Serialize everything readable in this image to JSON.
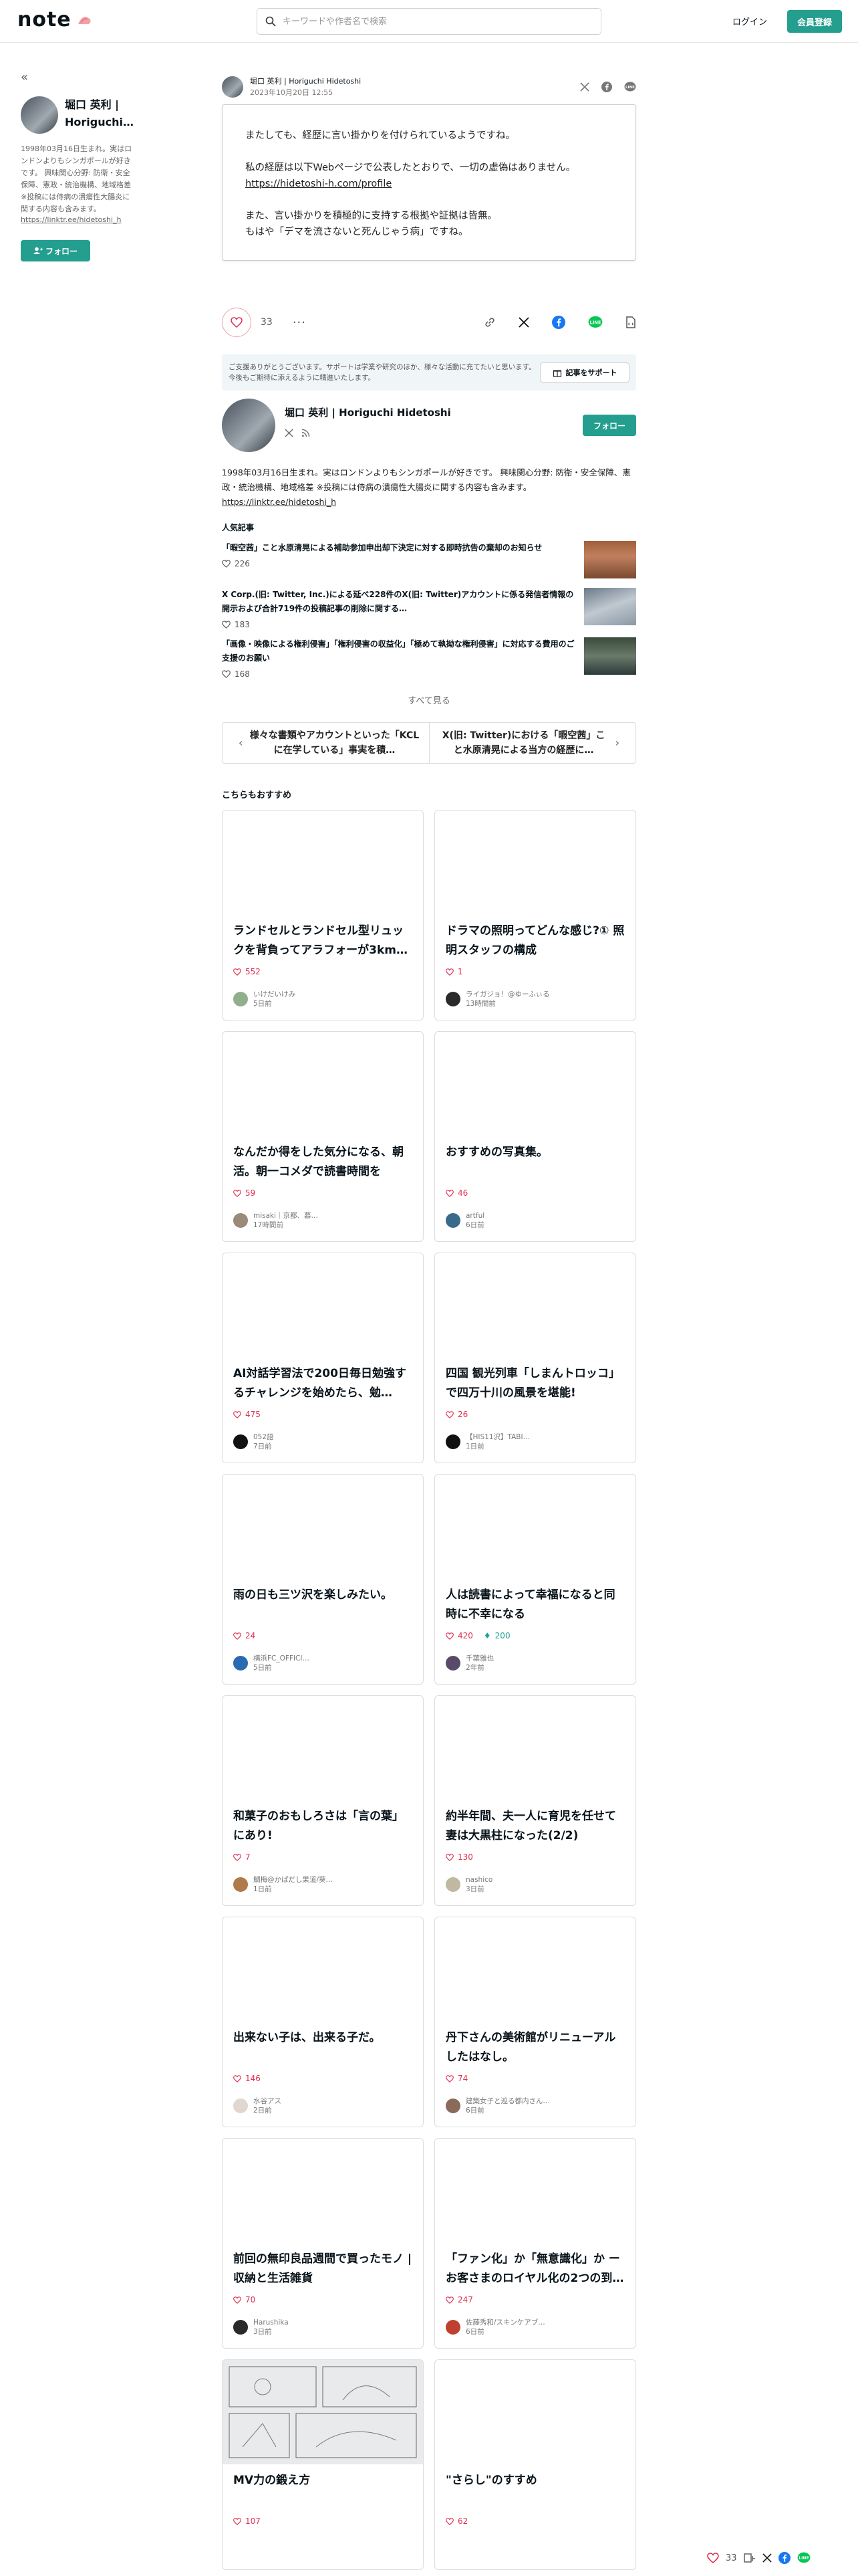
{
  "header": {
    "logo": "note",
    "search_placeholder": "キーワードや作者名で検索",
    "login": "ログイン",
    "signup": "会員登録"
  },
  "sidebar": {
    "name": "堀口 英利 | Horiguchi…",
    "bio": "1998年03月16日生まれ。実はロンドンよりもシンガポールが好きです。 興味関心分野: 防衛・安全保障、憲政・統治機構、地域格差 ※投稿には侍病の潰瘍性大腸炎に関する内容も含みます。",
    "link": "https://linktr.ee/hidetoshi_h",
    "follow": "フォロー"
  },
  "tweet": {
    "author": "堀口 英利 | Horiguchi Hidetoshi",
    "date": "2023年10月20日 12:55",
    "line1": "またしても、経歴に言い掛かりを付けられているようですね。",
    "line2": "私の経歴は以下Webページで公表したとおりで、一切の虚偽はありません。",
    "link": "https://hidetoshi-h.com/profile",
    "line3": "また、言い掛かりを積極的に支持する根拠や証拠は皆無。",
    "line4": "もはや「デマを流さないと死んじゃう病」ですね。"
  },
  "actions": {
    "like_count": "33",
    "more": "···"
  },
  "support": {
    "text": "ご支援ありがとうございます。サポートは学業や研究のほか、様々な活動に充てたいと思います。今後もご期待に添えるように精進いたします。",
    "button": "記事をサポート"
  },
  "author_card": {
    "name": "堀口 英利 | Horiguchi Hidetoshi",
    "follow": "フォロー",
    "bio": "1998年03月16日生まれ。実はロンドンよりもシンガポールが好きです。 興味関心分野: 防衛・安全保障、憲政・統治機構、地域格差 ※投稿には侍病の潰瘍性大腸炎に関する内容も含みます。",
    "link": "https://linktr.ee/hidetoshi_h"
  },
  "popular": {
    "title": "人気記事",
    "items": [
      {
        "title": "「暇空茜」こと水原清晃による補助参加申出却下決定に対する即時抗告の棄却のお知らせ",
        "likes": "226"
      },
      {
        "title": "X Corp.(旧: Twitter, Inc.)による延べ228件のX(旧: Twitter)アカウントに係る発信者情報の開示および合計719件の投稿記事の削除に関する…",
        "likes": "183"
      },
      {
        "title": "「画像・映像による権利侵害」「権利侵害の収益化」「極めて執拗な権利侵害」に対応する費用のご支援のお願い",
        "likes": "168"
      }
    ],
    "see_all": "すべて見る"
  },
  "pager": {
    "prev": "様々な書類やアカウントといった「KCLに在学している」事実を積…",
    "next": "X(旧: Twitter)における「暇空茜」こと水原清晃による当方の経歴に…"
  },
  "recommend": {
    "title": "こちらもおすすめ",
    "cards": [
      {
        "title": "ランドセルとランドセル型リュックを背負ってアラフォーが3km…",
        "likes": "552",
        "tips": "",
        "author": "いけだいけみ",
        "time": "5日前",
        "avatar": "#8fb08a"
      },
      {
        "title": "ドラマの照明ってどんな感じ?① 照明スタッフの構成",
        "likes": "1",
        "tips": "",
        "author": "ライガジョ！@ゆーふぃる",
        "time": "13時間前",
        "avatar": "#2a2a2a"
      },
      {
        "title": "なんだか得をした気分になる、朝活。朝一コメダで読書時間を",
        "likes": "59",
        "tips": "",
        "author": "misaki｜京都、暮…",
        "time": "17時間前",
        "avatar": "#9a8a7a"
      },
      {
        "title": "おすすめの写真集。",
        "likes": "46",
        "tips": "",
        "author": "artful",
        "time": "6日前",
        "avatar": "#3a6a8a"
      },
      {
        "title": "AI対話学習法で200日毎日勉強するチャレンジを始めたら、勉…",
        "likes": "475",
        "tips": "",
        "author": "052語",
        "time": "7日前",
        "avatar": "#111111"
      },
      {
        "title": "四国 観光列車「しまんトロッコ」で四万十川の風景を堪能!",
        "likes": "26",
        "tips": "",
        "author": "【HIS11沢】TABI…",
        "time": "1日前",
        "avatar": "#111111"
      },
      {
        "title": "雨の日も三ツ沢を楽しみたい。",
        "likes": "24",
        "tips": "",
        "author": "横浜FC_OFFICI…",
        "time": "5日前",
        "avatar": "#2a6ab0"
      },
      {
        "title": "人は読書によって幸福になると同時に不幸になる",
        "likes": "420",
        "tips": "200",
        "author": "千葉雅也",
        "time": "2年前",
        "avatar": "#5a4a6a"
      },
      {
        "title": "和菓子のおもしろさは「言の葉」にあり!",
        "likes": "7",
        "tips": "",
        "author": "鯛梅@かぱだし果道/葵…",
        "time": "1日前",
        "avatar": "#b07a4a"
      },
      {
        "title": "約半年間、夫一人に育児を任せて妻は大黒柱になった(2/2)",
        "likes": "130",
        "tips": "",
        "author": "nashico",
        "time": "3日前",
        "avatar": "#c0b8a0"
      },
      {
        "title": "出来ない子は、出来る子だ。",
        "likes": "146",
        "tips": "",
        "author": "水谷アス",
        "time": "2日前",
        "avatar": "#e0d8d0"
      },
      {
        "title": "丹下さんの美術館がリニューアルしたはなし。",
        "likes": "74",
        "tips": "",
        "author": "建築女子と巡る都内さん…",
        "time": "6日前",
        "avatar": "#8a6a5a"
      },
      {
        "title": "前回の無印良品週間で買ったモノ | 収納と生活雑貨",
        "likes": "70",
        "tips": "",
        "author": "Harushika",
        "time": "3日前",
        "avatar": "#2a2a2a"
      },
      {
        "title": "「ファン化」か「無意識化」か ーお客さまのロイヤル化の2つの到…",
        "likes": "247",
        "tips": "",
        "author": "佐藤秀和/スキンケアブ…",
        "time": "6日前",
        "avatar": "#c04030"
      },
      {
        "title": "MV力の鍛え方",
        "likes": "107",
        "tips": "",
        "author": "",
        "time": "",
        "avatar": "#ffffff",
        "image": true
      },
      {
        "title": "\"さらし\"のすすめ",
        "likes": "62",
        "tips": "",
        "author": "",
        "time": "",
        "avatar": "#ffffff"
      }
    ]
  },
  "sticky": {
    "likes": "33"
  }
}
